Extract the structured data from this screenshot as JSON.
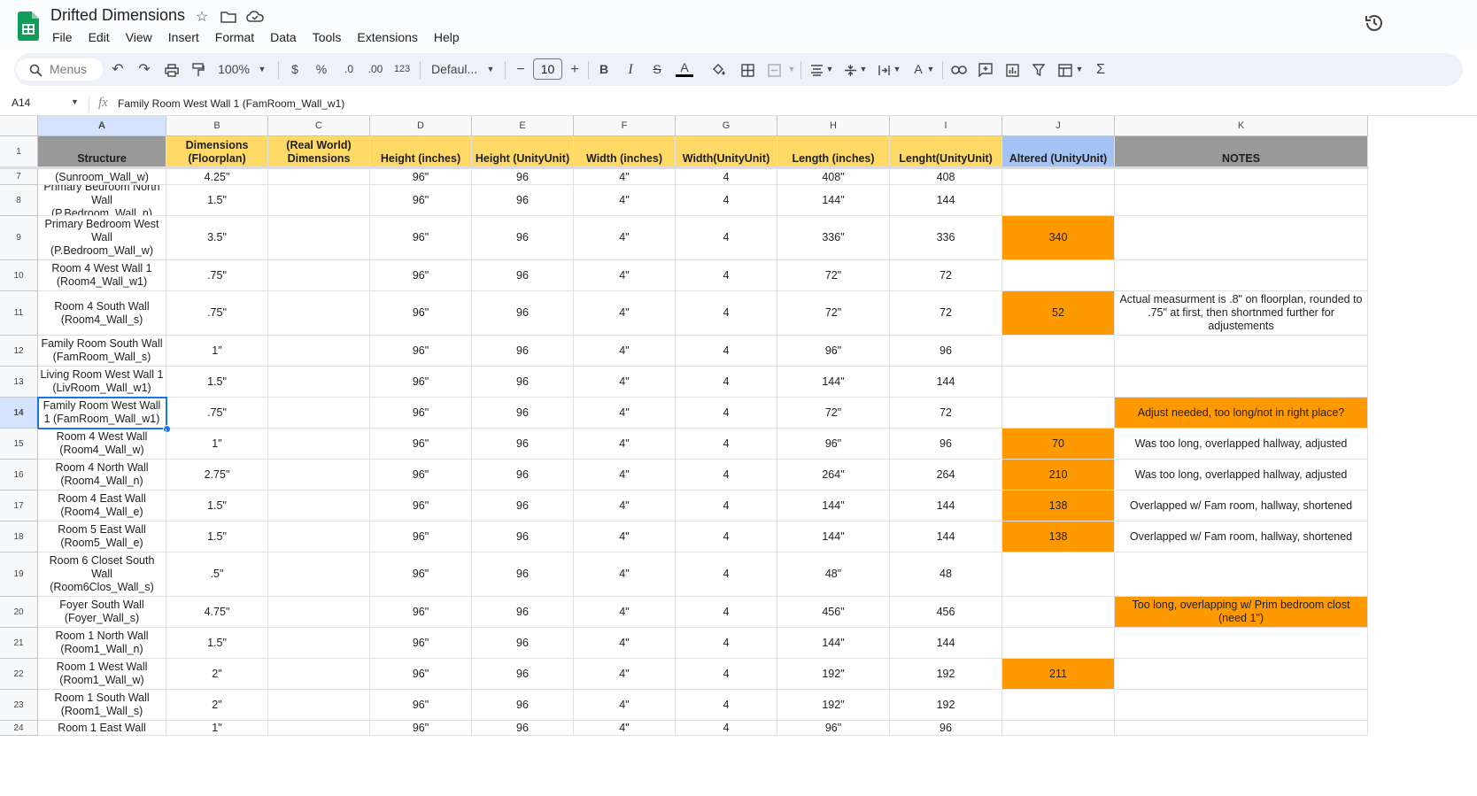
{
  "app": {
    "title": "Drifted Dimensions",
    "menus": [
      "File",
      "Edit",
      "View",
      "Insert",
      "Format",
      "Data",
      "Tools",
      "Extensions",
      "Help"
    ]
  },
  "toolbar": {
    "search_placeholder": "Menus",
    "zoom": "100%",
    "currency": "$",
    "percent": "%",
    "dec_decrease": ".0",
    "dec_increase": ".00",
    "number_format": "123",
    "font": "Defaul...",
    "font_size": "10",
    "minus": "−",
    "plus": "+",
    "bold": "B",
    "italic": "I",
    "strike": "S",
    "text_color": "A",
    "text_color2": "A",
    "sum": "Σ"
  },
  "formula_bar": {
    "cell_ref": "A14",
    "fx": "fx",
    "content": "Family Room West Wall 1 (FamRoom_Wall_w1)"
  },
  "colors": {
    "header_yellow": "#ffd966",
    "header_gray": "#999999",
    "header_blue": "#a4c2f4",
    "highlight_orange": "#ff9900",
    "selection_blue": "#1a73e8"
  },
  "sheet": {
    "columns": [
      "A",
      "B",
      "C",
      "D",
      "E",
      "F",
      "G",
      "H",
      "I",
      "J",
      "K"
    ],
    "header_row_label": "1",
    "headers": [
      "Structure",
      "Dimensions (Floorplan)",
      "(Real World) Dimensions",
      "Height (inches)",
      "Height (UnityUnit)",
      "Width (inches)",
      "Width(UnityUnit)",
      "Length (inches)",
      "Lenght(UnityUnit)",
      "Altered (UnityUnit)",
      "NOTES"
    ],
    "rows": [
      {
        "n": "7",
        "cells": [
          "Sunroom West Wall (Sunroom_Wall_w)",
          "4.25\"",
          "",
          "96\"",
          "96",
          "4\"",
          "4",
          "408\"",
          "408",
          "",
          ""
        ],
        "hl": []
      },
      {
        "n": "8",
        "cells": [
          "Primary Bedroom North Wall (P.Bedroom_Wall_n)",
          "1.5\"",
          "",
          "96\"",
          "96",
          "4\"",
          "4",
          "144\"",
          "144",
          "",
          ""
        ],
        "hl": []
      },
      {
        "n": "9",
        "cells": [
          "Primary Bedroom West Wall (P.Bedroom_Wall_w)",
          "3.5\"",
          "",
          "96\"",
          "96",
          "4\"",
          "4",
          "336\"",
          "336",
          "340",
          ""
        ],
        "hl": [
          9
        ]
      },
      {
        "n": "10",
        "cells": [
          "Room 4 West Wall 1 (Room4_Wall_w1)",
          ".75\"",
          "",
          "96\"",
          "96",
          "4\"",
          "4",
          "72\"",
          "72",
          "",
          ""
        ],
        "hl": []
      },
      {
        "n": "11",
        "cells": [
          "Room 4 South Wall (Room4_Wall_s)",
          ".75\"",
          "",
          "96\"",
          "96",
          "4\"",
          "4",
          "72\"",
          "72",
          "52",
          "Actual measurment is .8\" on floorplan, rounded to .75\" at first, then shortnmed further for adjustements"
        ],
        "hl": [
          9
        ]
      },
      {
        "n": "12",
        "cells": [
          "Family Room South Wall (FamRoom_Wall_s)",
          "1\"",
          "",
          "96\"",
          "96",
          "4\"",
          "4",
          "96\"",
          "96",
          "",
          ""
        ],
        "hl": []
      },
      {
        "n": "13",
        "cells": [
          "Living Room West Wall 1 (LivRoom_Wall_w1)",
          "1.5\"",
          "",
          "96\"",
          "96",
          "4\"",
          "4",
          "144\"",
          "144",
          "",
          ""
        ],
        "hl": []
      },
      {
        "n": "14",
        "cells": [
          "Family Room West Wall 1 (FamRoom_Wall_w1)",
          ".75\"",
          "",
          "96\"",
          "96",
          "4\"",
          "4",
          "72\"",
          "72",
          "",
          "Adjust needed, too long/not in right place?"
        ],
        "hl": [
          10
        ]
      },
      {
        "n": "15",
        "cells": [
          "Room 4 West Wall (Room4_Wall_w)",
          "1\"",
          "",
          "96\"",
          "96",
          "4\"",
          "4",
          "96\"",
          "96",
          "70",
          "Was too long, overlapped hallway, adjusted"
        ],
        "hl": [
          9
        ]
      },
      {
        "n": "16",
        "cells": [
          "Room 4 North Wall (Room4_Wall_n)",
          "2.75\"",
          "",
          "96\"",
          "96",
          "4\"",
          "4",
          "264\"",
          "264",
          "210",
          "Was too long, overlapped hallway, adjusted"
        ],
        "hl": [
          9
        ]
      },
      {
        "n": "17",
        "cells": [
          "Room 4 East Wall (Room4_Wall_e)",
          "1.5\"",
          "",
          "96\"",
          "96",
          "4\"",
          "4",
          "144\"",
          "144",
          "138",
          "Overlapped w/ Fam room, hallway, shortened"
        ],
        "hl": [
          9
        ]
      },
      {
        "n": "18",
        "cells": [
          "Room 5 East Wall (Room5_Wall_e)",
          "1.5\"",
          "",
          "96\"",
          "96",
          "4\"",
          "4",
          "144\"",
          "144",
          "138",
          "Overlapped w/ Fam room, hallway, shortened"
        ],
        "hl": [
          9
        ]
      },
      {
        "n": "19",
        "cells": [
          "Room 6 Closet South Wall (Room6Clos_Wall_s)",
          ".5\"",
          "",
          "96\"",
          "96",
          "4\"",
          "4",
          "48\"",
          "48",
          "",
          ""
        ],
        "hl": []
      },
      {
        "n": "20",
        "cells": [
          "Foyer South Wall (Foyer_Wall_s)",
          "4.75\"",
          "",
          "96\"",
          "96",
          "4\"",
          "4",
          "456\"",
          "456",
          "",
          "Too long, overlapping w/ Prim bedroom clost (need 1\")"
        ],
        "hl": [
          10
        ]
      },
      {
        "n": "21",
        "cells": [
          "Room 1 North Wall (Room1_Wall_n)",
          "1.5\"",
          "",
          "96\"",
          "96",
          "4\"",
          "4",
          "144\"",
          "144",
          "",
          ""
        ],
        "hl": []
      },
      {
        "n": "22",
        "cells": [
          "Room 1 West Wall (Room1_Wall_w)",
          "2\"",
          "",
          "96\"",
          "96",
          "4\"",
          "4",
          "192\"",
          "192",
          "211",
          ""
        ],
        "hl": [
          9
        ]
      },
      {
        "n": "23",
        "cells": [
          "Room 1 South Wall (Room1_Wall_s)",
          "2\"",
          "",
          "96\"",
          "96",
          "4\"",
          "4",
          "192\"",
          "192",
          "",
          ""
        ],
        "hl": []
      },
      {
        "n": "24",
        "cells": [
          "Room 1 East Wall",
          "1\"",
          "",
          "96\"",
          "96",
          "4\"",
          "4",
          "96\"",
          "96",
          "",
          ""
        ],
        "hl": []
      }
    ]
  }
}
